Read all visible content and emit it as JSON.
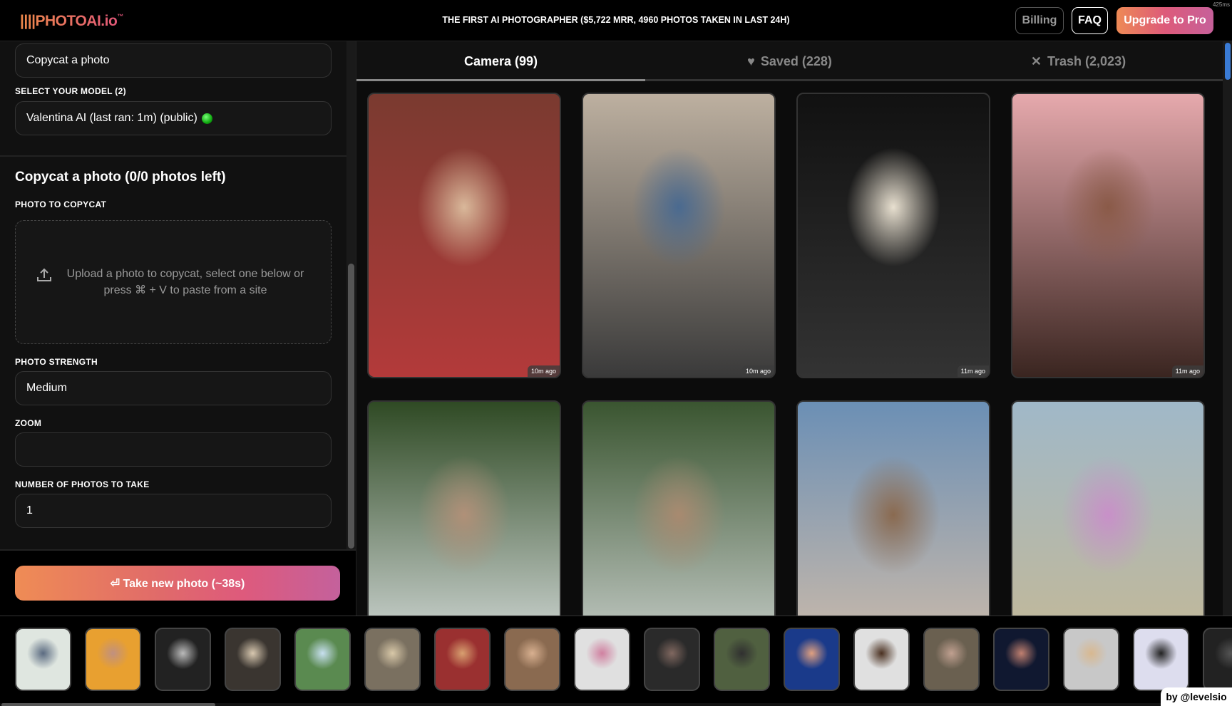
{
  "header": {
    "logo": "||||PHOTOAI.io",
    "logo_tm": "™",
    "tagline": "THE FIRST AI PHOTOGRAPHER ($5,722 MRR, 4960 PHOTOS TAKEN IN LAST 24H)",
    "billing": "Billing",
    "faq": "FAQ",
    "upgrade": "Upgrade to Pro",
    "render_time": "425ms"
  },
  "sidebar": {
    "mode_value": "Copycat a photo",
    "model_label": "SELECT YOUR MODEL (2)",
    "model_value": "Valentina AI (last ran: 1m) (public)",
    "model_status_color": "#22bb22",
    "section_title": "Copycat a photo (0/0 photos left)",
    "photo_label": "PHOTO TO COPYCAT",
    "upload_text": "Upload a photo to copycat, select one below or press ⌘ + V to paste from a site",
    "strength_label": "PHOTO STRENGTH",
    "strength_value": "Medium",
    "zoom_label": "ZOOM",
    "zoom_value": "",
    "count_label": "NUMBER OF PHOTOS TO TAKE",
    "count_value": "1",
    "take_button": "⏎ Take new photo (~38s)"
  },
  "tabs": [
    {
      "label": "Camera (99)",
      "icon": "camera"
    },
    {
      "label": "Saved (228)",
      "icon": "heart-icon"
    },
    {
      "label": "Trash (2,023)",
      "icon": "x-icon"
    }
  ],
  "photos": [
    {
      "ago": "10m ago",
      "colors": [
        "#7a3a30",
        "#b33a3a",
        "#d9b89a"
      ]
    },
    {
      "ago": "10m ago",
      "colors": [
        "#bdb0a0",
        "#3a3a3a",
        "#4a6a90"
      ]
    },
    {
      "ago": "11m ago",
      "colors": [
        "#111",
        "#333",
        "#e8e0d0"
      ]
    },
    {
      "ago": "11m ago",
      "colors": [
        "#e6a9ad",
        "#3a2520",
        "#8a5a48"
      ]
    },
    {
      "ago": "",
      "colors": [
        "#2f4a24",
        "#e8ecef",
        "#b09078"
      ]
    },
    {
      "ago": "",
      "colors": [
        "#3a5530",
        "#d8dcdc",
        "#a88a70"
      ]
    },
    {
      "ago": "",
      "colors": [
        "#6b8fb5",
        "#d8c0a8",
        "#8a6a50"
      ]
    },
    {
      "ago": "",
      "colors": [
        "#a0b8c8",
        "#c8b890",
        "#c890c8"
      ]
    }
  ],
  "thumbnails": [
    [
      "#dfe6e0",
      "#5a6a80"
    ],
    [
      "#e8a030",
      "#c09080"
    ],
    [
      "#222",
      "#bbb"
    ],
    [
      "#3a3530",
      "#d8c8b0"
    ],
    [
      "#5a8a50",
      "#c8e0f0"
    ],
    [
      "#7a7060",
      "#d8c8a8"
    ],
    [
      "#9a3030",
      "#d8a070"
    ],
    [
      "#8a6a50",
      "#d8b090"
    ],
    [
      "#e0e0e0",
      "#d080a0"
    ],
    [
      "#2a2a2a",
      "#806860"
    ],
    [
      "#506040",
      "#303030"
    ],
    [
      "#1a3a8a",
      "#e0a080"
    ],
    [
      "#e0e0e0",
      "#4a3020"
    ],
    [
      "#6a6050",
      "#c0a090"
    ],
    [
      "#101830",
      "#c08070"
    ],
    [
      "#c8c8c8",
      "#d8b890"
    ],
    [
      "#dde",
      "#222"
    ],
    [
      "#222",
      "#555"
    ]
  ],
  "footer": {
    "by": "by @levelsio"
  }
}
